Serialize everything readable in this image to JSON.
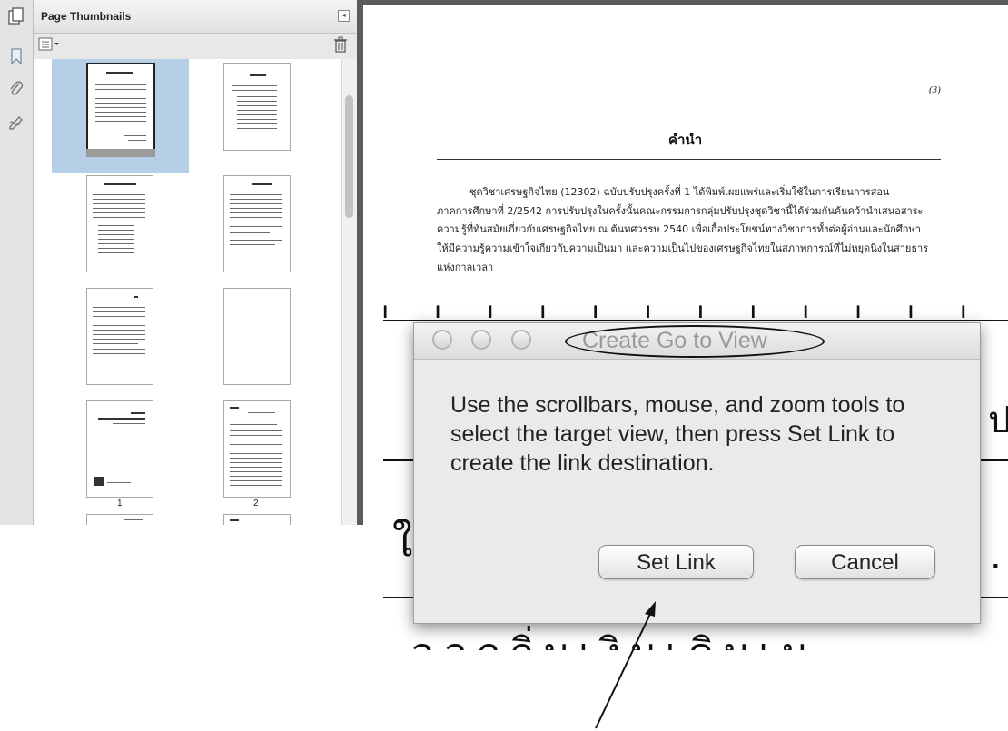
{
  "sidebar": {
    "panel_title": "Page Thumbnails",
    "page_labels": [
      "1",
      "2"
    ]
  },
  "document": {
    "page_number": "(3)",
    "heading": "คำนำ",
    "paragraph_lines": [
      "ชุดวิชาเศรษฐกิจไทย (12302)  ฉบับปรับปรุงครั้งที่ 1 ได้พิมพ์เผยแพร่และเริ่มใช้ในการเรียนการสอน",
      "ภาคการศึกษาที่ 2/2542 การปรับปรุงในครั้งนั้นคณะกรรมการกลุ่มปรับปรุงชุดวิชานี้ได้ร่วมกันค้นคว้านำเสนอสาระ",
      "ความรู้ที่ทันสมัยเกี่ยวกับเศรษฐกิจไทย ณ ต้นทศวรรษ 2540 เพื่อเกื้อประโยชน์ทางวิชาการทั้งต่อผู้อ่านและนักศึกษา",
      "ให้มีความรู้ความเข้าใจเกี่ยวกับความเป็นมา และความเป็นไปของเศรษฐกิจไทยในสภาพการณ์ที่ไม่หยุดนิ่งในสายธาร",
      "แห่งกาลเวลา"
    ]
  },
  "dialog": {
    "title": "Create Go to View",
    "message": "Use the scrollbars, mouse, and zoom tools to select the target view, then press Set Link to create the link destination.",
    "set_link_label": "Set Link",
    "cancel_label": "Cancel"
  }
}
